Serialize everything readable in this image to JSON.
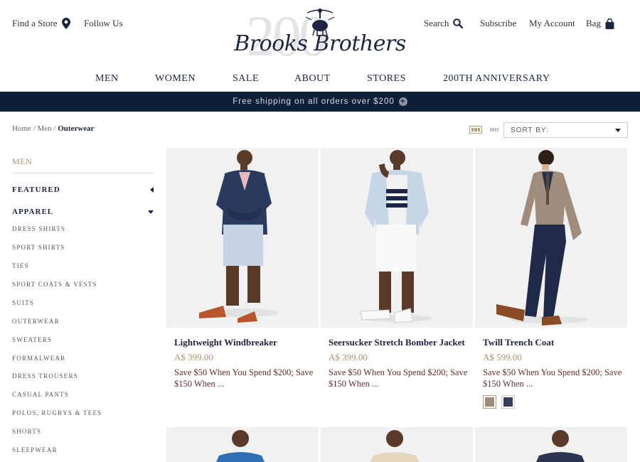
{
  "header": {
    "find_store": "Find a Store",
    "follow_us": "Follow Us",
    "search": "Search",
    "subscribe": "Subscribe",
    "my_account": "My Account",
    "bag": "Bag",
    "logo_number": "200",
    "logo_text": "Brooks Brothers"
  },
  "nav": {
    "items": [
      "MEN",
      "WOMEN",
      "SALE",
      "ABOUT",
      "STORES",
      "200TH ANNIVERSARY"
    ]
  },
  "promo_banner": {
    "text": "Free shipping on all orders over $200",
    "icon": "plus-circle-icon"
  },
  "breadcrumb": {
    "home": "Home",
    "men": "Men",
    "current": "Outerwear"
  },
  "sort": {
    "label": "SORT BY:"
  },
  "sidebar": {
    "title": "MEN",
    "featured": "FEATURED",
    "apparel": "APPAREL",
    "items": [
      "DRESS SHIRTS",
      "SPORT SHIRTS",
      "TIES",
      "SPORT COATS & VESTS",
      "SUITS",
      "OUTERWEAR",
      "SWEATERS",
      "FORMALWEAR",
      "DRESS TROUSERS",
      "CASUAL PANTS",
      "POLOS, RUGBYS & TEES",
      "SHORTS",
      "SLEEPWEAR"
    ]
  },
  "products": [
    {
      "name": "Lightweight Windbreaker",
      "price": "A$ 399.00",
      "promo": "Save $50 When You Spend $200; Save $150 When ..."
    },
    {
      "name": "Seersucker Stretch Bomber Jacket",
      "price": "A$ 399.00",
      "promo": "Save $50 When You Spend $200; Save $150 When ..."
    },
    {
      "name": "Twill Trench Coat",
      "price": "A$ 599.00",
      "promo": "Save $50 When You Spend $200; Save $150 When ...",
      "swatches": [
        "#a08c7c",
        "#34405a"
      ]
    }
  ],
  "colors": {
    "navy": "#1c2541",
    "banner": "#0f1f38",
    "gold": "#a89470",
    "promo_red": "#6b2c2c"
  }
}
